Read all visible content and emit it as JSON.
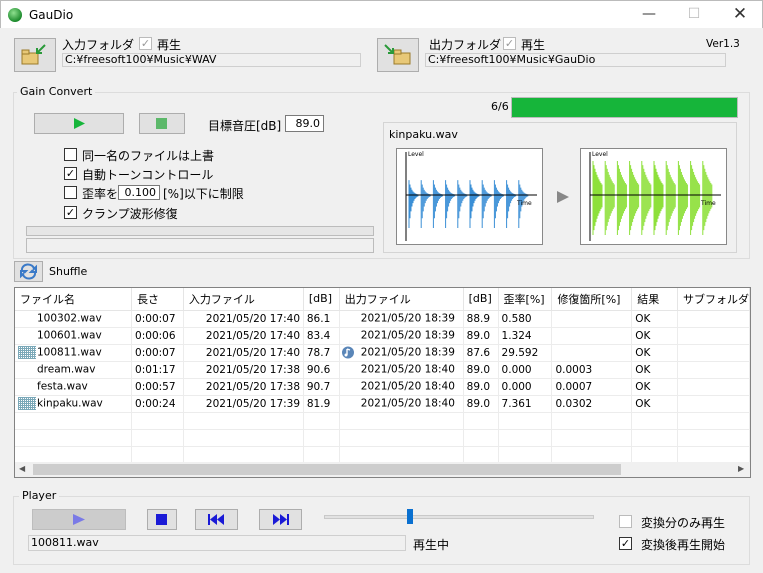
{
  "window": {
    "title": "GauDio",
    "version": "Ver1.3"
  },
  "input": {
    "label": "入力フォルダ",
    "play_label": "再生",
    "path": "C:¥freesoft100¥Music¥WAV"
  },
  "output": {
    "label": "出力フォルダ",
    "play_label": "再生",
    "path": "C:¥freesoft100¥Music¥GauDio"
  },
  "gain": {
    "title": "Gain Convert",
    "target_label": "目標音圧[dB]",
    "target_value": "89.0",
    "progress_text": "6/6",
    "progress_fraction": 1.0,
    "options": [
      {
        "label": "同一名のファイルは上書",
        "checked": false
      },
      {
        "label": "自動トーンコントロール",
        "checked": true
      },
      {
        "label_before": "歪率を",
        "value": "0.100",
        "label_after": "[%]以下に制限",
        "checked": false
      },
      {
        "label": "クランプ波形修復",
        "checked": true
      }
    ]
  },
  "waveform": {
    "filename": "kinpaku.wav",
    "level_label": "Level",
    "time_label": "Time"
  },
  "shuffle_label": "Shuffle",
  "table": {
    "headers": [
      "ファイル名",
      "長さ",
      "入力ファイル",
      "[dB]",
      "出力ファイル",
      "[dB]",
      "歪率[%]",
      "修復箇所[%]",
      "結果",
      "サブフォルダ"
    ],
    "rows": [
      {
        "name": "100302.wav",
        "len": "0:00:07",
        "in": "2021/05/20 17:40",
        "indb": "86.1",
        "out": "2021/05/20 18:39",
        "outdb": "88.9",
        "dist": "0.580",
        "fix": "",
        "res": "OK",
        "sub": "",
        "mark": false,
        "playing": false
      },
      {
        "name": "100601.wav",
        "len": "0:00:06",
        "in": "2021/05/20 17:40",
        "indb": "83.4",
        "out": "2021/05/20 18:39",
        "outdb": "89.0",
        "dist": "1.324",
        "fix": "",
        "res": "OK",
        "sub": "",
        "mark": false,
        "playing": false
      },
      {
        "name": "100811.wav",
        "len": "0:00:07",
        "in": "2021/05/20 17:40",
        "indb": "78.7",
        "out": "2021/05/20 18:39",
        "outdb": "87.6",
        "dist": "29.592",
        "fix": "",
        "res": "OK",
        "sub": "",
        "mark": true,
        "playing": true
      },
      {
        "name": "dream.wav",
        "len": "0:01:17",
        "in": "2021/05/20 17:38",
        "indb": "90.6",
        "out": "2021/05/20 18:40",
        "outdb": "89.0",
        "dist": "0.000",
        "fix": "0.0003",
        "res": "OK",
        "sub": "",
        "mark": false,
        "playing": false
      },
      {
        "name": "festa.wav",
        "len": "0:00:57",
        "in": "2021/05/20 17:38",
        "indb": "90.7",
        "out": "2021/05/20 18:40",
        "outdb": "89.0",
        "dist": "0.000",
        "fix": "0.0007",
        "res": "OK",
        "sub": "",
        "mark": false,
        "playing": false
      },
      {
        "name": "kinpaku.wav",
        "len": "0:00:24",
        "in": "2021/05/20 17:39",
        "indb": "81.9",
        "out": "2021/05/20 18:40",
        "outdb": "89.0",
        "dist": "7.361",
        "fix": "0.0302",
        "res": "OK",
        "sub": "",
        "mark": true,
        "playing": false
      }
    ]
  },
  "player": {
    "title": "Player",
    "current_file": "100811.wav",
    "status": "再生中",
    "position_fraction": 0.32,
    "opt1": {
      "label": "変換分のみ再生",
      "checked": false
    },
    "opt2": {
      "label": "変換後再生開始",
      "checked": true
    }
  },
  "colors": {
    "accent_green": "#16b53a",
    "wave_blue": "#3a8fd6",
    "wave_green": "#8ee03a",
    "play_blue": "#3a3ad6"
  }
}
